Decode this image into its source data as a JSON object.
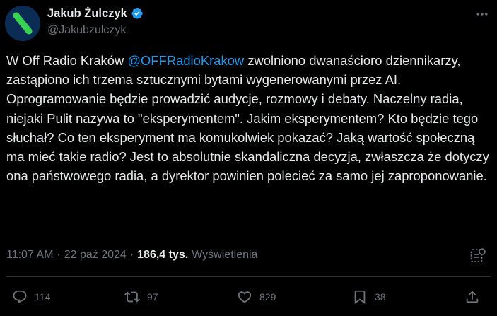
{
  "author": {
    "name": "Jakub Żulczyk",
    "handle": "@Jakubzulczyk",
    "verified": true
  },
  "tweet": {
    "text_parts": {
      "p1": "W Off Radio Kraków ",
      "mention": "@OFFRadioKrakow",
      "p2": " zwolniono dwanaścioro dziennikarzy, zastąpiono ich trzema sztucznymi bytami wygenerowanymi przez AI. Oprogramowanie będzie prowadzić audycje, rozmowy i debaty. Naczelny radia, niejaki Pulit nazywa to \"eksperymentem\". Jakim eksperymentem? Kto będzie tego słuchał? Co ten eksperyment ma komukolwiek pokazać? Jaką wartość społeczną ma mieć takie radio? Jest to absolutnie skandaliczna decyzja, zwłaszcza że dotyczy ona państwowego radia, a dyrektor powinien polecieć za samo jej zaproponowanie."
    },
    "time": "11:07 AM",
    "separator": "·",
    "date": "22 paź 2024",
    "views_count": "186,4 tys.",
    "views_label": "Wyświetlenia"
  },
  "actions": {
    "replies": "114",
    "reposts": "97",
    "likes": "829",
    "bookmarks": "38"
  },
  "colors": {
    "background": "#000000",
    "text": "#e7e9ea",
    "secondary": "#71767b",
    "accent": "#1d9bf0",
    "divider": "#2f3336",
    "avatar_bg": "#0b2c54",
    "avatar_mark": "#39d353"
  },
  "icons": {
    "verified": "verified-badge-icon",
    "more": "more-dots-icon",
    "grok": "grok-icon",
    "reply": "reply-icon",
    "repost": "repost-icon",
    "like": "heart-icon",
    "bookmark": "bookmark-icon",
    "share": "share-icon"
  }
}
